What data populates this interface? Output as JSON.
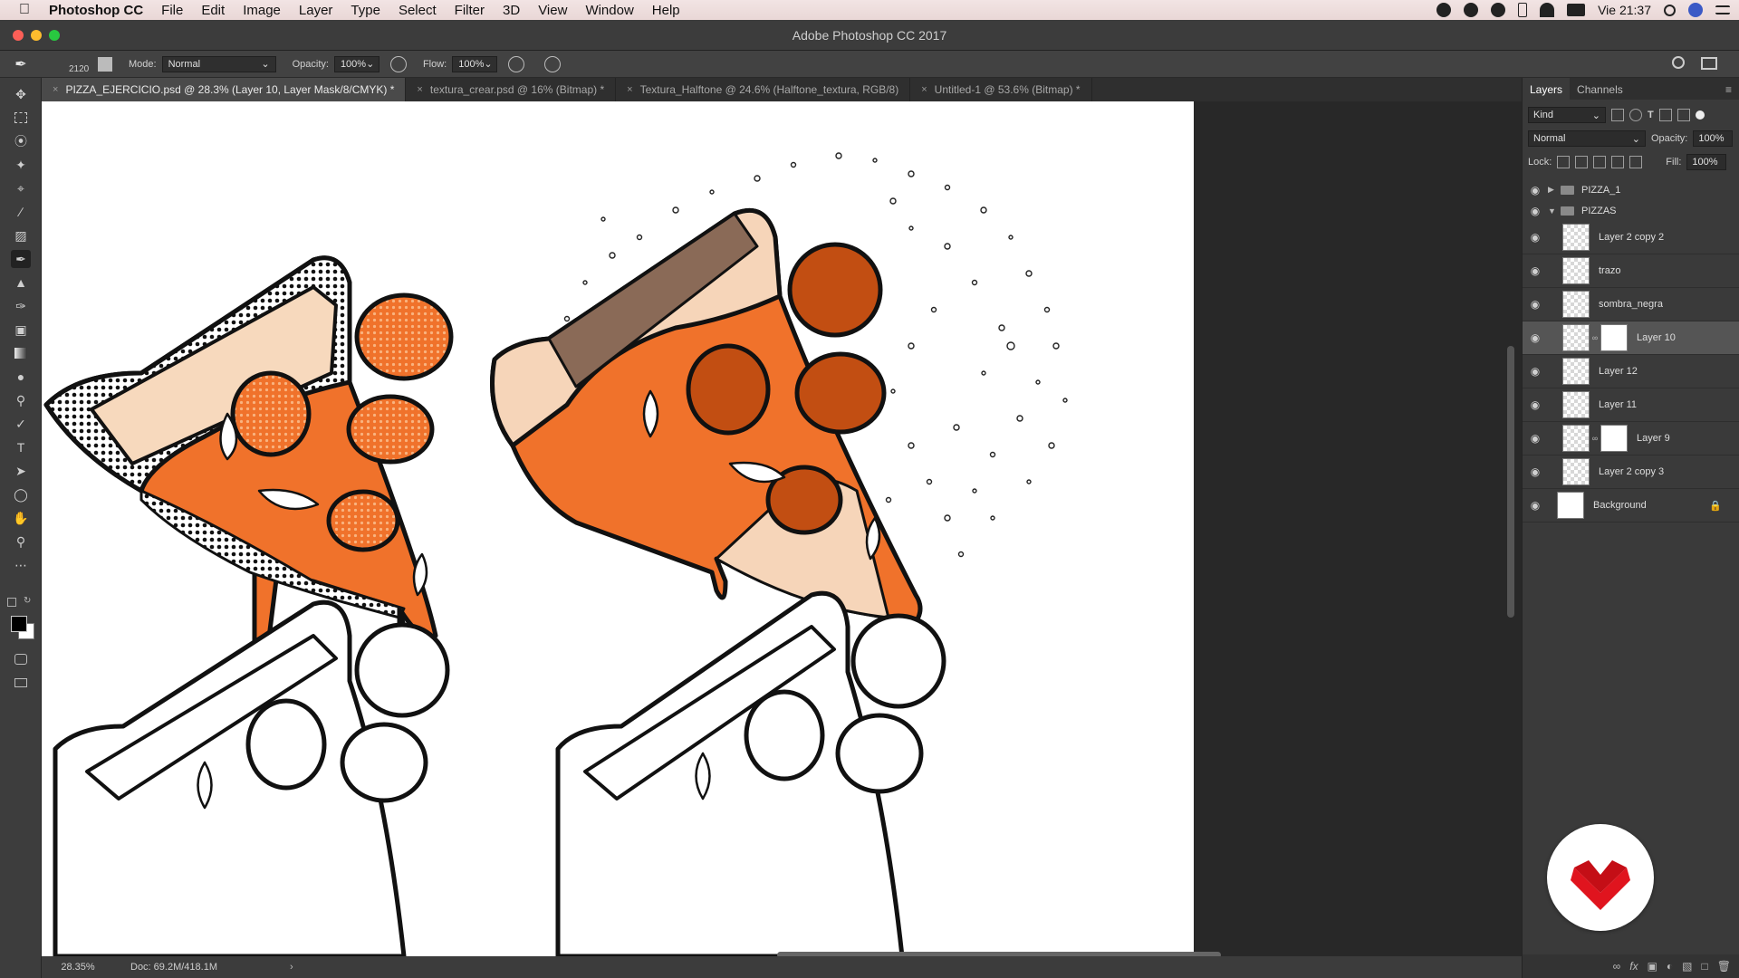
{
  "menubar": {
    "app_name": "Photoshop CC",
    "items": [
      "File",
      "Edit",
      "Image",
      "Layer",
      "Type",
      "Select",
      "Filter",
      "3D",
      "View",
      "Window",
      "Help"
    ],
    "clock": "Vie 21:37"
  },
  "window": {
    "title": "Adobe Photoshop CC 2017"
  },
  "options": {
    "brush_size": "2120",
    "mode_label": "Mode:",
    "mode_value": "Normal",
    "opacity_label": "Opacity:",
    "opacity_value": "100%",
    "flow_label": "Flow:",
    "flow_value": "100%"
  },
  "tabs": [
    {
      "label": "PIZZA_EJERCICIO.psd @ 28.3% (Layer 10, Layer Mask/8/CMYK) *"
    },
    {
      "label": "textura_crear.psd @ 16% (Bitmap) *"
    },
    {
      "label": "Textura_Halftone @ 24.6% (Halftone_textura, RGB/8)"
    },
    {
      "label": "Untitled-1 @ 53.6% (Bitmap) *"
    }
  ],
  "status": {
    "zoom": "28.35%",
    "doc": "Doc: 69.2M/418.1M"
  },
  "panel": {
    "tabs": [
      "Layers",
      "Channels"
    ],
    "kind_label": "Kind",
    "blend_mode": "Normal",
    "opacity_label": "Opacity:",
    "opacity_value": "100%",
    "lock_label": "Lock:",
    "fill_label": "Fill:",
    "fill_value": "100%",
    "layers": [
      {
        "name": "PIZZA_1"
      },
      {
        "name": "PIZZAS"
      },
      {
        "name": "Layer 2 copy 2"
      },
      {
        "name": "trazo"
      },
      {
        "name": "sombra_negra"
      },
      {
        "name": "Layer 10"
      },
      {
        "name": "Layer 12"
      },
      {
        "name": "Layer 11"
      },
      {
        "name": "Layer 9"
      },
      {
        "name": "Layer 2 copy 3"
      },
      {
        "name": "Background"
      }
    ]
  },
  "colors": {
    "pizza_orange": "#f0722b",
    "crust": "#f6d5b9",
    "brand_red": "#e0141e"
  }
}
